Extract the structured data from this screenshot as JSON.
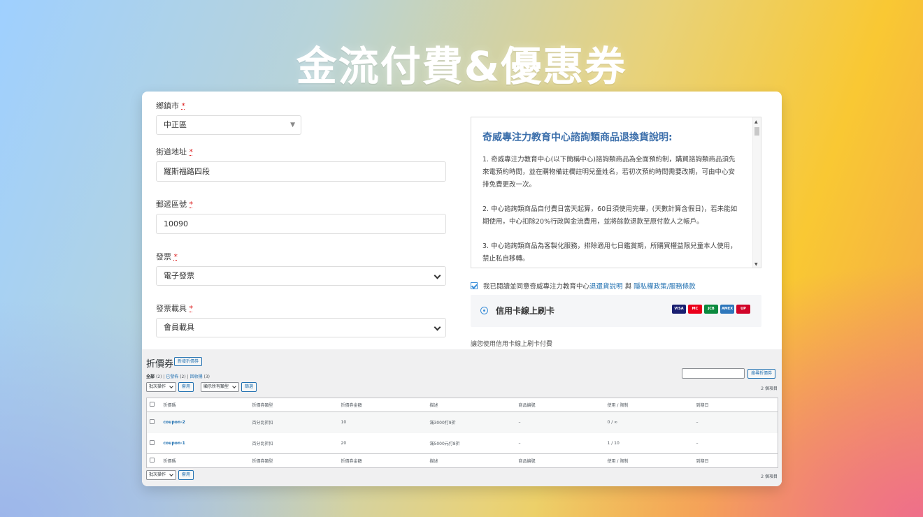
{
  "hero": {
    "title": "金流付費&優惠券"
  },
  "form": {
    "district": {
      "label": "鄉鎮市",
      "required": "*",
      "value": "中正區"
    },
    "street": {
      "label": "街道地址",
      "required": "*",
      "value": "羅斯福路四段"
    },
    "postcode": {
      "label": "郵遞區號",
      "required": "*",
      "value": "10090"
    },
    "invoice": {
      "label": "發票",
      "required": "*",
      "value": "電子發票"
    },
    "carrier": {
      "label": "發票載具",
      "required": "*",
      "value": "會員載具"
    }
  },
  "policy": {
    "title": "奇威專注力教育中心諮詢類商品退換貨說明:",
    "items": [
      "1. 奇威專注力教育中心(以下簡稱中心)諮詢類商品為全面預約制，購買諮詢類商品須先來電預約時間，並在購物備註欄註明兒童姓名，若初次預約時間需要改期，可由中心安排免費更改一次。",
      "2. 中心諮詢類商品自付費日當天起算，60日須使用完畢，(天數計算含假日)，若未能如期使用，中心扣除20%行政與金流費用，並將餘款退款至原付款人之帳戶。",
      "3. 中心諮詢類商品為客製化服務，排除適用七日鑑賞期，所購買權益限兒童本人使用，禁止私自移轉。"
    ]
  },
  "agree": {
    "prefix": "我已閱讀並同意奇威專注力教育中心",
    "link1": "退還貨說明",
    "mid": "與",
    "link2": "隱私權政策/服務條款"
  },
  "payment": {
    "label": "信用卡線上刷卡",
    "note": "讓您使用信用卡線上刷卡付費",
    "cards": [
      {
        "name": "VISA",
        "color": "#1a1f71"
      },
      {
        "name": "MC",
        "color": "#eb001b"
      },
      {
        "name": "JCB",
        "color": "#0b8a3e"
      },
      {
        "name": "AMEX",
        "color": "#2e77bb"
      },
      {
        "name": "UP",
        "color": "#d10429"
      }
    ]
  },
  "admin": {
    "title": "折價券",
    "add_button": "新增折價券",
    "views": {
      "all": "全部",
      "all_count": "(2)",
      "published": "已發佈",
      "published_count": "(2)",
      "trash": "回收桶",
      "trash_count": "(3)"
    },
    "search_button": "搜尋折價券",
    "bulk_select": "批次操作",
    "apply": "套用",
    "type_select": "顯示所有類型",
    "filter": "篩選",
    "count": "2 個項目",
    "columns": [
      "折價碼",
      "折價券類型",
      "折價券金額",
      "描述",
      "商品編號",
      "使用 / 限制",
      "到期日"
    ],
    "rows": [
      {
        "code": "coupon-2",
        "type": "百分比折扣",
        "amount": "10",
        "desc": "滿3000打9折",
        "product": "–",
        "usage": "0 / ∞",
        "expiry": "–"
      },
      {
        "code": "coupon-1",
        "type": "百分比折扣",
        "amount": "20",
        "desc": "滿5000元打8折",
        "product": "–",
        "usage": "1 / 10",
        "expiry": "–"
      }
    ]
  }
}
